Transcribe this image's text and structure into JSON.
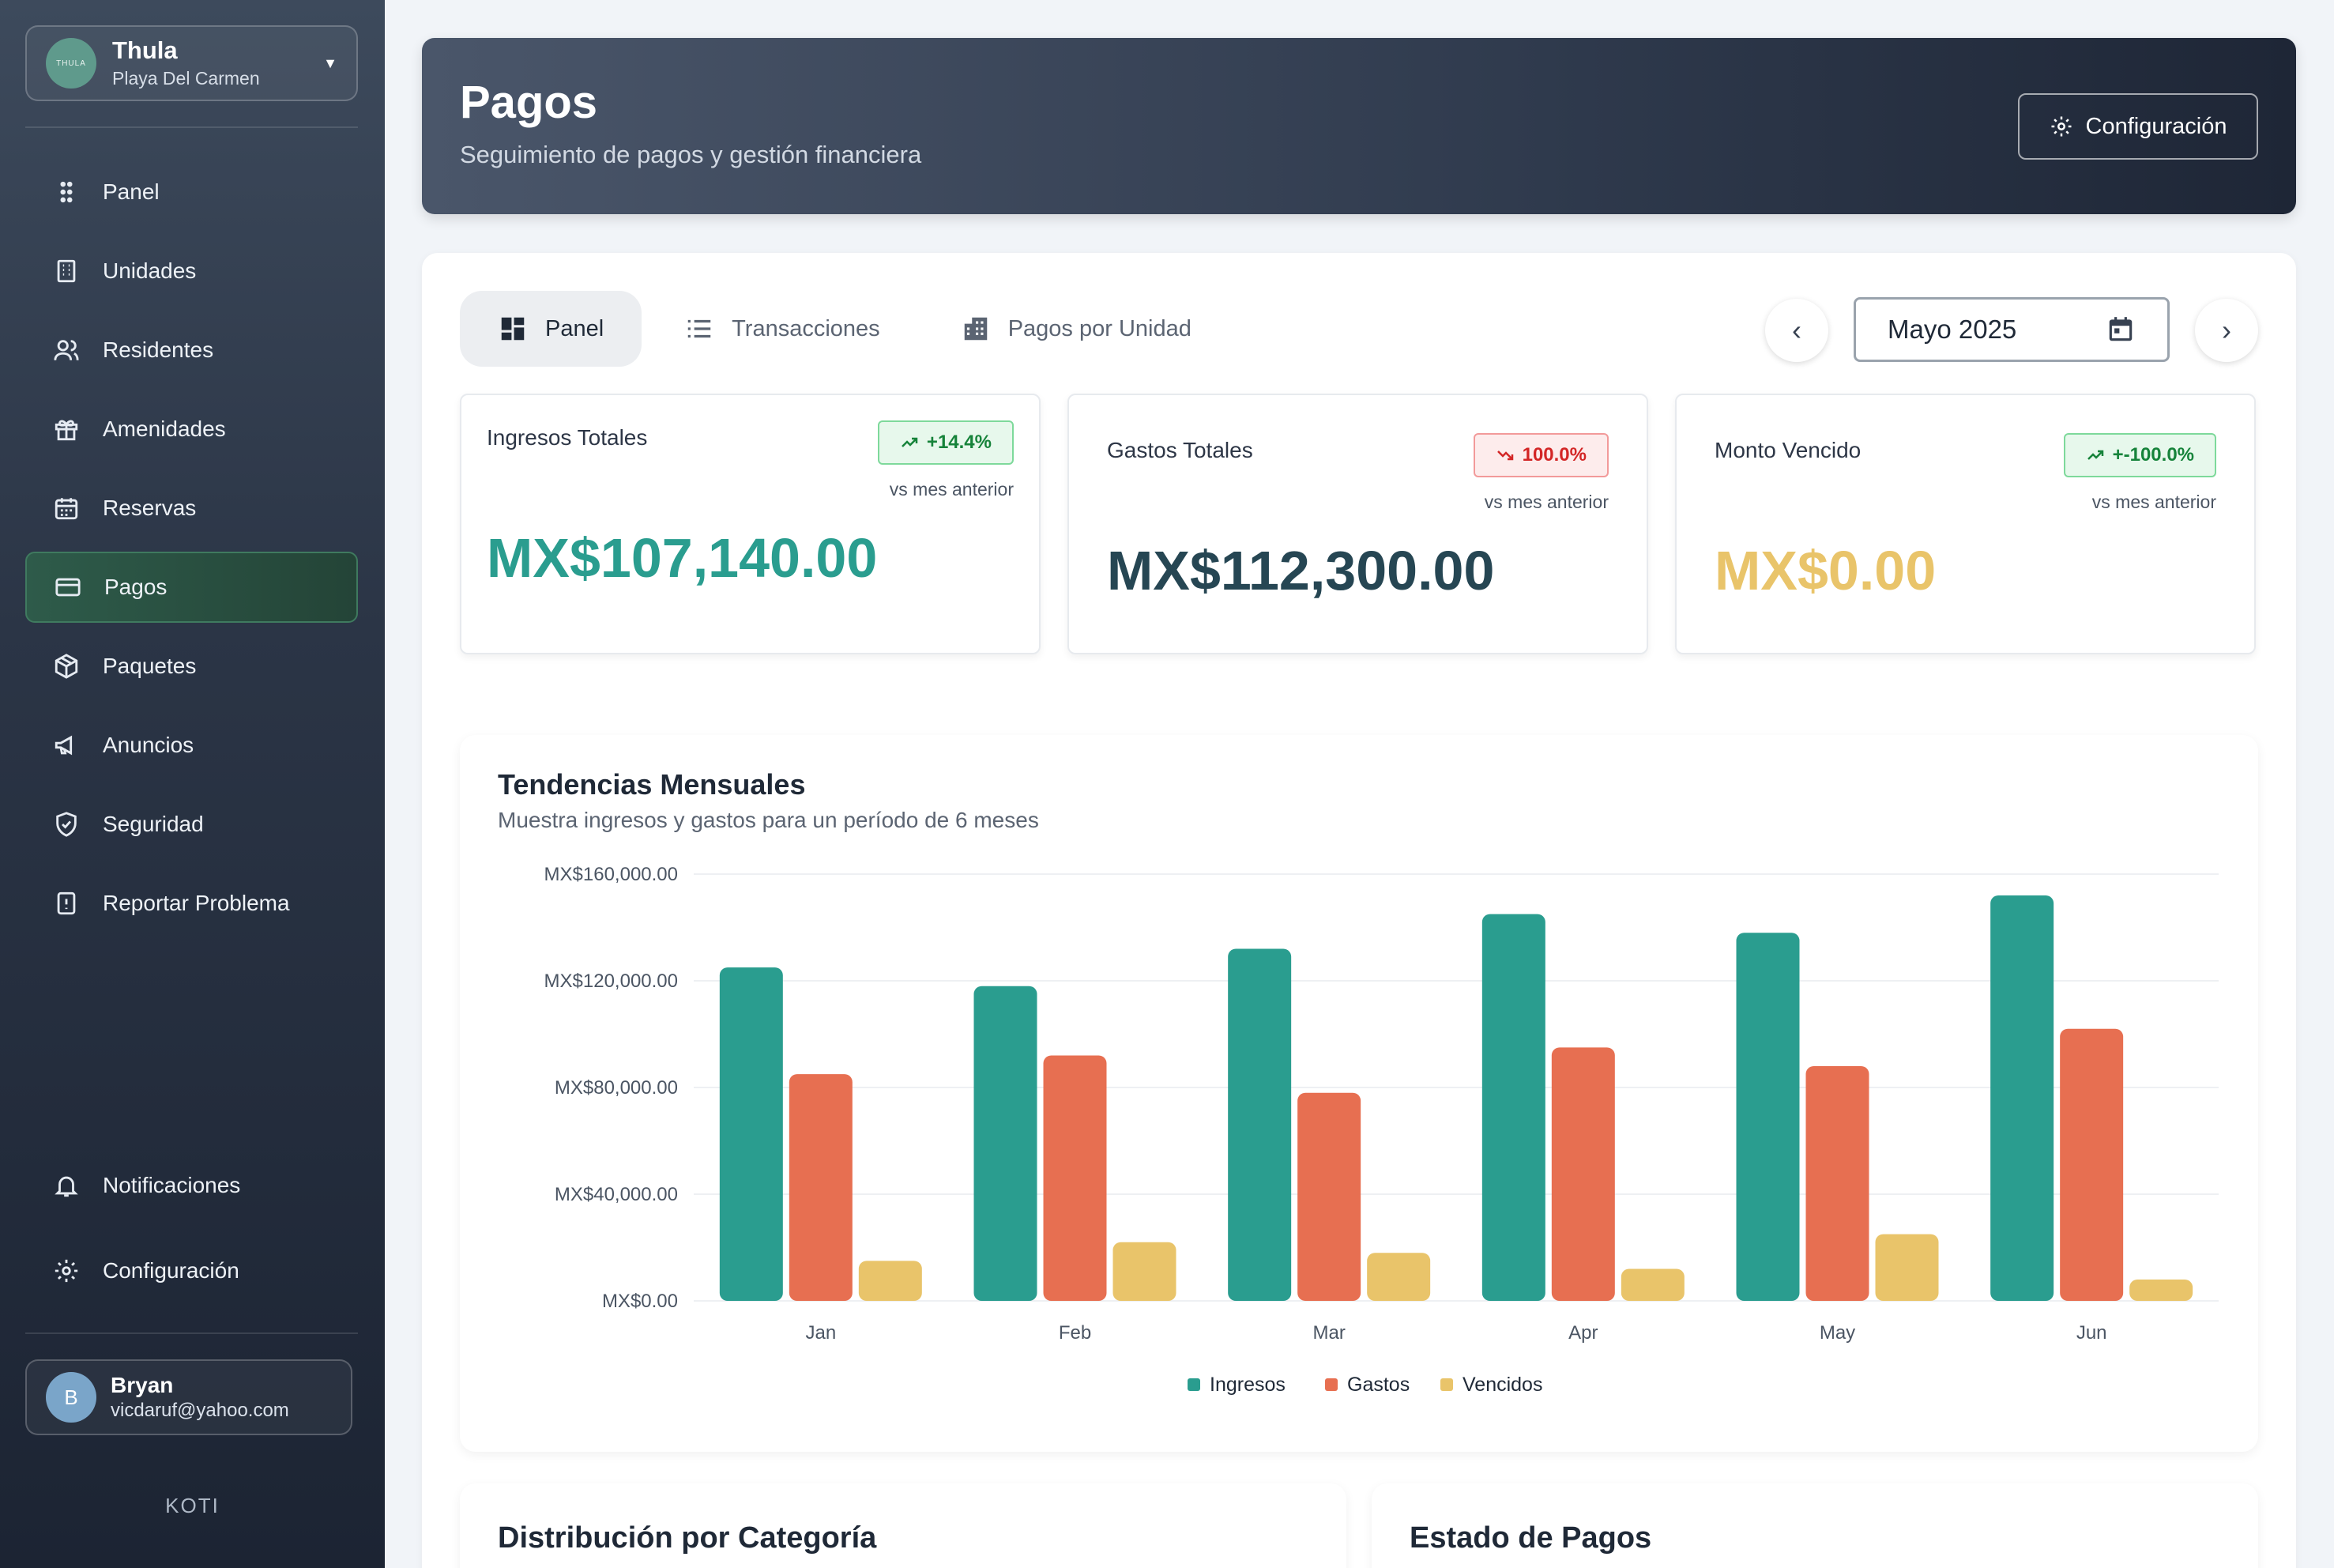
{
  "org": {
    "name": "Thula",
    "location": "Playa Del Carmen",
    "logo_text": "THULA"
  },
  "nav": {
    "items": [
      {
        "label": "Panel",
        "icon": "grid-dots-icon"
      },
      {
        "label": "Unidades",
        "icon": "building-icon"
      },
      {
        "label": "Residentes",
        "icon": "users-icon"
      },
      {
        "label": "Amenidades",
        "icon": "gift-icon"
      },
      {
        "label": "Reservas",
        "icon": "calendar-icon"
      },
      {
        "label": "Pagos",
        "icon": "credit-card-icon",
        "active": true
      },
      {
        "label": "Paquetes",
        "icon": "package-icon"
      },
      {
        "label": "Anuncios",
        "icon": "megaphone-icon"
      },
      {
        "label": "Seguridad",
        "icon": "shield-icon"
      },
      {
        "label": "Reportar Problema",
        "icon": "report-icon"
      }
    ],
    "bottom": [
      {
        "label": "Notificaciones",
        "icon": "bell-icon"
      },
      {
        "label": "Configuración",
        "icon": "gear-icon"
      }
    ]
  },
  "user": {
    "name": "Bryan",
    "email": "vicdaruf@yahoo.com",
    "initial": "B"
  },
  "brand": "KOTI",
  "header": {
    "title": "Pagos",
    "subtitle": "Seguimiento de pagos y gestión financiera",
    "config_label": "Configuración"
  },
  "tabs": [
    {
      "label": "Panel",
      "active": true
    },
    {
      "label": "Transacciones"
    },
    {
      "label": "Pagos por Unidad"
    }
  ],
  "month": {
    "value": "Mayo 2025",
    "prev": "‹",
    "next": "›"
  },
  "stats": [
    {
      "label": "Ingresos Totales",
      "badge": "+14.4%",
      "trend": "up",
      "vs": "vs mes anterior",
      "value": "MX$107,140.00",
      "color": "#2a9d8f"
    },
    {
      "label": "Gastos Totales",
      "badge": "100.0%",
      "trend": "down",
      "vs": "vs mes anterior",
      "value": "MX$112,300.00",
      "color": "#264653"
    },
    {
      "label": "Monto Vencido",
      "badge": "+-100.0%",
      "trend": "up",
      "vs": "vs mes anterior",
      "value": "MX$0.00",
      "color": "#e9c46a"
    }
  ],
  "chart": {
    "title": "Tendencias Mensuales",
    "subtitle": "Muestra ingresos y gastos para un período de 6 meses"
  },
  "chart_data": {
    "type": "bar",
    "categories": [
      "Jan",
      "Feb",
      "Mar",
      "Apr",
      "May",
      "Jun"
    ],
    "series": [
      {
        "name": "Ingresos",
        "color": "#2a9d8f",
        "values": [
          125000,
          118000,
          132000,
          145000,
          138000,
          152000
        ]
      },
      {
        "name": "Gastos",
        "color": "#e76f51",
        "values": [
          85000,
          92000,
          78000,
          95000,
          88000,
          102000
        ]
      },
      {
        "name": "Vencidos",
        "color": "#e9c46a",
        "values": [
          15000,
          22000,
          18000,
          12000,
          25000,
          8000
        ]
      }
    ],
    "yticks": [
      "MX$0.00",
      "MX$40,000.00",
      "MX$80,000.00",
      "MX$120,000.00",
      "MX$160,000.00"
    ],
    "ylim": [
      0,
      160000
    ],
    "grid": true,
    "legend": "bottom"
  },
  "bottom_cards": [
    {
      "title": "Distribución por Categoría"
    },
    {
      "title": "Estado de Pagos"
    }
  ]
}
